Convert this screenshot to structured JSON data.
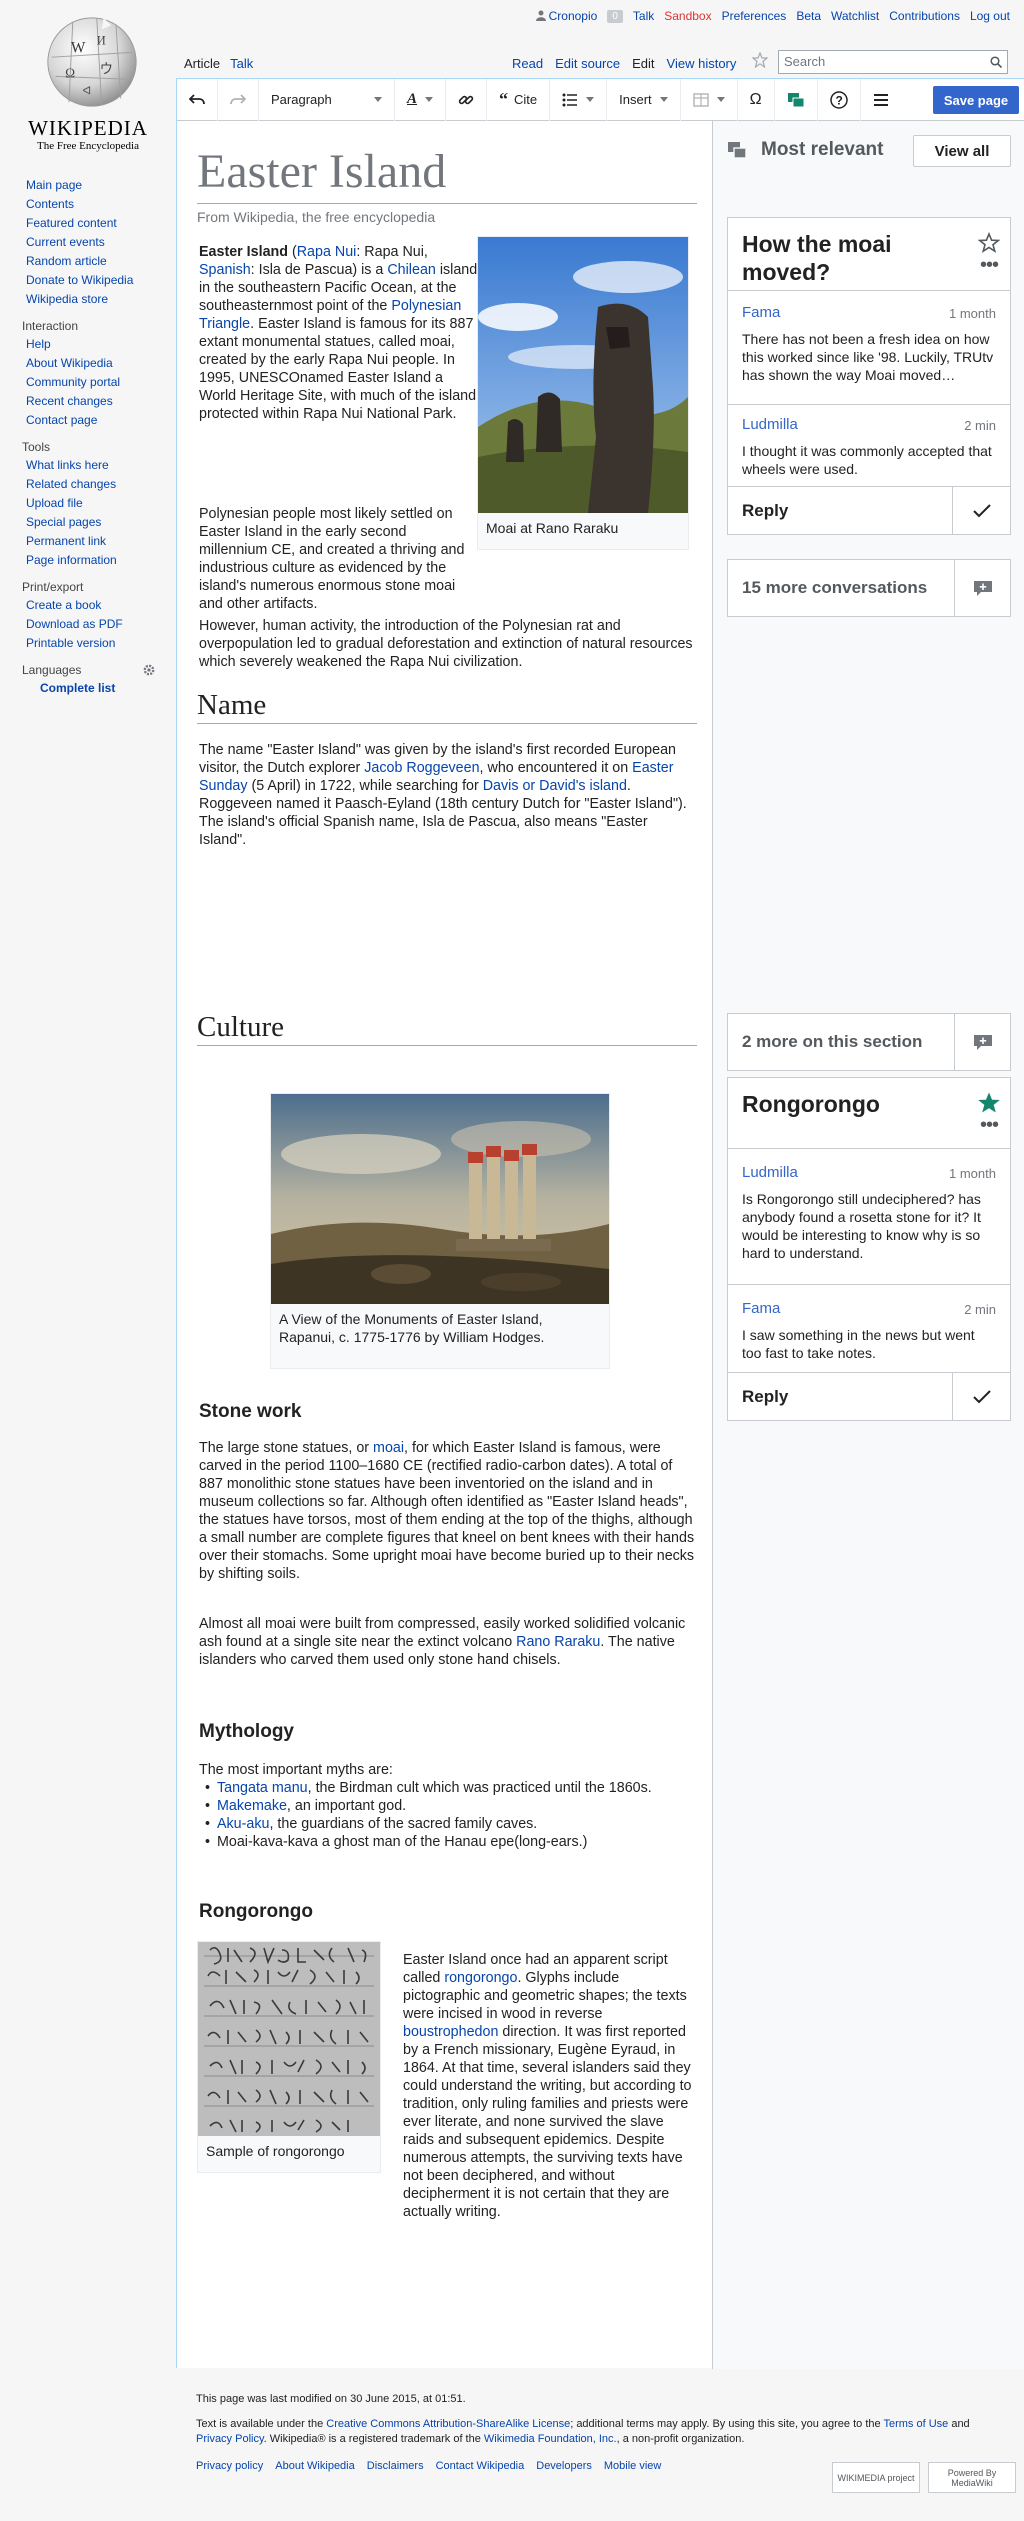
{
  "logo": {
    "wordmark": "WIKIPEDIA",
    "tagline": "The Free Encyclopedia"
  },
  "personal": {
    "username": "Cronopio",
    "notifications": "0",
    "talk": "Talk",
    "sandbox": "Sandbox",
    "preferences": "Preferences",
    "beta": "Beta",
    "watchlist": "Watchlist",
    "contributions": "Contributions",
    "logout": "Log out"
  },
  "tabs": {
    "article": "Article",
    "talk": "Talk",
    "read": "Read",
    "edit_source": "Edit source",
    "edit": "Edit",
    "view_history": "View history"
  },
  "search": {
    "placeholder": "Search"
  },
  "toolbar": {
    "format": "Paragraph",
    "text_style": "A",
    "cite": "Cite",
    "insert": "Insert",
    "save": "Save page"
  },
  "sidebar": {
    "navigation": [
      "Main page",
      "Contents",
      "Featured content",
      "Current events",
      "Random article",
      "Donate to Wikipedia",
      "Wikipedia store"
    ],
    "interaction_title": "Interaction",
    "interaction": [
      "Help",
      "About Wikipedia",
      "Community portal",
      "Recent changes",
      "Contact page"
    ],
    "tools_title": "Tools",
    "tools": [
      "What links here",
      "Related changes",
      "Upload file",
      "Special pages",
      "Permanent link",
      "Page information"
    ],
    "print_title": "Print/export",
    "print": [
      "Create a book",
      "Download as PDF",
      "Printable version"
    ],
    "languages_title": "Languages",
    "complete_list": "Complete list"
  },
  "article": {
    "title": "Easter Island",
    "from": "From Wikipedia, the free encyclopedia",
    "intro": {
      "bold": "Easter Island",
      "t1": " (",
      "l1": "Rapa Nui",
      "t2": ": Rapa Nui, ",
      "l2": "Spanish",
      "t3": ": Isla de Pascua) is a ",
      "l3": "Chilean",
      "t4": " island in the southeastern Pacific Ocean, at the southeasternmost point of the ",
      "l4": "Polynesian Triangle",
      "t5": ". Easter Island is famous for its 887 extant monumental statues, called moai, created by the early Rapa Nui people. In 1995, UNESCOnamed Easter Island a World Heritage Site, with much of the island protected within Rapa Nui National Park."
    },
    "intro2": "Polynesian people most likely settled on Easter Island in the early second millennium CE, and created a thriving and industrious culture as evidenced by the island's numerous enormous stone moai and other artifacts.",
    "intro3": "However, human activity, the introduction of the Polynesian rat and overpopulation led to gradual deforestation and extinction of natural resources which severely weakened the Rapa Nui civilization.",
    "image1_caption": "Moai at Rano Raraku",
    "name_heading": "Name",
    "name": {
      "t1": "The name \"Easter Island\" was given by the island's first recorded European visitor, the Dutch explorer ",
      "l1": "Jacob Roggeveen",
      "t2": ", who encountered it on ",
      "l2": "Easter Sunday",
      "t3": " (5 April) in 1722, while searching for ",
      "l3": "Davis or David's island",
      "t4": ". Roggeveen named it Paasch-Eyland (18th century Dutch for \"Easter Island\"). The island's official Spanish name, Isla de Pascua, also means \"Easter Island\"."
    },
    "culture_heading": "Culture",
    "image2_caption": "A View of the Monuments of Easter Island, Rapanui, c. 1775-1776 by William Hodges.",
    "stone_heading": "Stone work",
    "stone1": {
      "t1": "The large stone statues, or ",
      "l1": "moai",
      "t2": ", for which Easter Island is famous, were carved in the period 1100–1680 CE (rectified radio-carbon dates). A total of 887 monolithic stone statues have been inventoried on the island and in museum collections so far. Although often identified as \"Easter Island heads\", the statues have torsos, most of them ending at the top of the thighs, although a small number are complete figures that kneel on bent knees with their hands over their stomachs. Some upright moai have become buried up to their necks by shifting soils."
    },
    "stone2": {
      "t1": "Almost all moai were built from compressed, easily worked solidified volcanic ash found at a single site near the extinct volcano ",
      "l1": "Rano Raraku",
      "t2": ". The native islanders who carved them used only stone hand chisels."
    },
    "myth_heading": "Mythology",
    "myth_intro": "The most important myths are:",
    "myths": [
      {
        "link": "Tangata manu",
        "text": ", the Birdman cult which was practiced until the 1860s."
      },
      {
        "link": "Makemake",
        "text": ", an important god."
      },
      {
        "link": "Aku-aku",
        "text": ", the guardians of the sacred family caves."
      },
      {
        "link": "",
        "text": "Moai-kava-kava a ghost man of the Hanau epe(long-ears.)"
      }
    ],
    "rongo_heading": "Rongorongo",
    "image3_caption": "Sample of rongorongo",
    "rongo": {
      "t1": "Easter Island once had an apparent script called ",
      "l1": "rongorongo",
      "t2": ". Glyphs include pictographic and geometric shapes; the texts were incised in wood in reverse ",
      "l2": "boustrophedon",
      "t3": " direction. It was first reported by a French missionary, Eugène Eyraud, in 1864. At that time, several islanders said they could understand the writing, but according to tradition, only ruling families and priests were ever literate, and none survived the slave raids and subsequent epidemics. Despite numerous attempts, the surviving texts have not been deciphered, and without decipherment it is not certain that they are actually writing."
    }
  },
  "flow": {
    "header_title": "Most relevant",
    "view_all": "View all",
    "topic1": {
      "title": "How the moai moved?",
      "posts": [
        {
          "author": "Fama",
          "time": "1 month",
          "body": "There has not been a fresh idea on how this worked since like '98. Luckily, TRUtv has shown the way Moai moved…"
        },
        {
          "author": "Ludmilla",
          "time": "2 min",
          "body": "I thought it was commonly accepted that wheels were used."
        }
      ],
      "reply": "Reply"
    },
    "more_conversations": "15 more conversations",
    "more_section": "2 more on this section",
    "topic2": {
      "title": "Rongorongo",
      "posts": [
        {
          "author": "Ludmilla",
          "time": "1 month",
          "body": "Is Rongorongo still undeciphered? has anybody found a rosetta stone for it? It would be interesting to know why is so hard to understand."
        },
        {
          "author": "Fama",
          "time": "2 min",
          "body": "I saw something in the news but went too fast to take notes."
        }
      ],
      "reply": "Reply"
    },
    "accent_color": "#14866d"
  },
  "footer": {
    "modified": "This page was last modified on 30 June 2015, at 01:51.",
    "license_t1": "Text is available under the ",
    "license_link": "Creative Commons Attribution-ShareAlike License",
    "license_t2": "; additional terms may apply. By using this site, you agree to the ",
    "terms_link": "Terms of Use",
    "license_t3": " and ",
    "privacy_link": "Privacy Policy",
    "license_t4": ". Wikipedia® is a registered trademark of the ",
    "foundation_link": "Wikimedia Foundation, Inc.",
    "license_t5": ", a non-profit organization.",
    "links": [
      "Privacy policy",
      "About Wikipedia",
      "Disclaimers",
      "Contact Wikipedia",
      "Developers",
      "Mobile view"
    ],
    "badge1": "WIKIMEDIA project",
    "badge2": "Powered By MediaWiki"
  }
}
